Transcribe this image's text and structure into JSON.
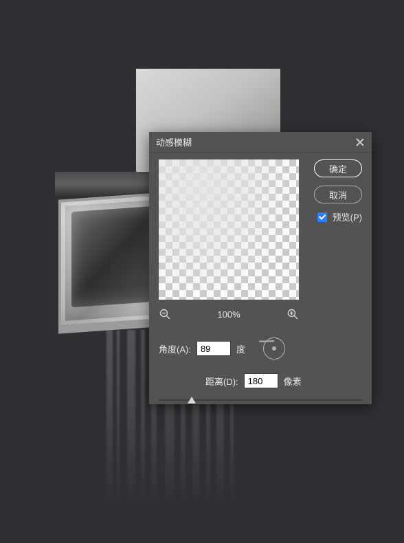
{
  "dialog": {
    "title": "动感模糊",
    "ok_label": "确定",
    "cancel_label": "取消",
    "preview_label": "预览(P)",
    "zoom_level": "100%",
    "angle": {
      "label": "角度(A):",
      "value": "89",
      "unit": "度"
    },
    "distance": {
      "label": "距离(D):",
      "value": "180",
      "unit": "像素"
    }
  }
}
